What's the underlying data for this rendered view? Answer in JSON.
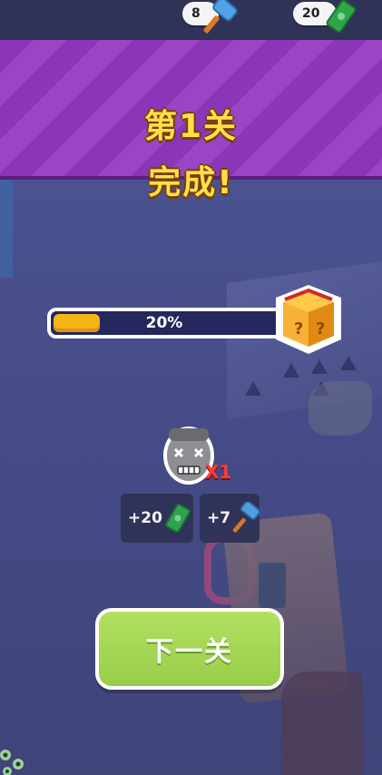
{
  "hud": {
    "hammers": "8",
    "cash": "20"
  },
  "banner": {
    "line1": "第1关",
    "line2": "完成!"
  },
  "progress": {
    "value": 0.2,
    "label": "20%"
  },
  "kills": {
    "multiplier": "X1"
  },
  "rewards": {
    "cash": "+20",
    "hammers": "+7"
  },
  "next_button": {
    "label": "下一关"
  },
  "colors": {
    "banner": "#8b36b6",
    "title": "#ffe04a",
    "progress_fill": "#f5b514",
    "button": "#a4d655"
  },
  "icons": [
    "hammer-icon",
    "cash-icon",
    "mystery-chest-icon",
    "zombie-head-icon"
  ]
}
